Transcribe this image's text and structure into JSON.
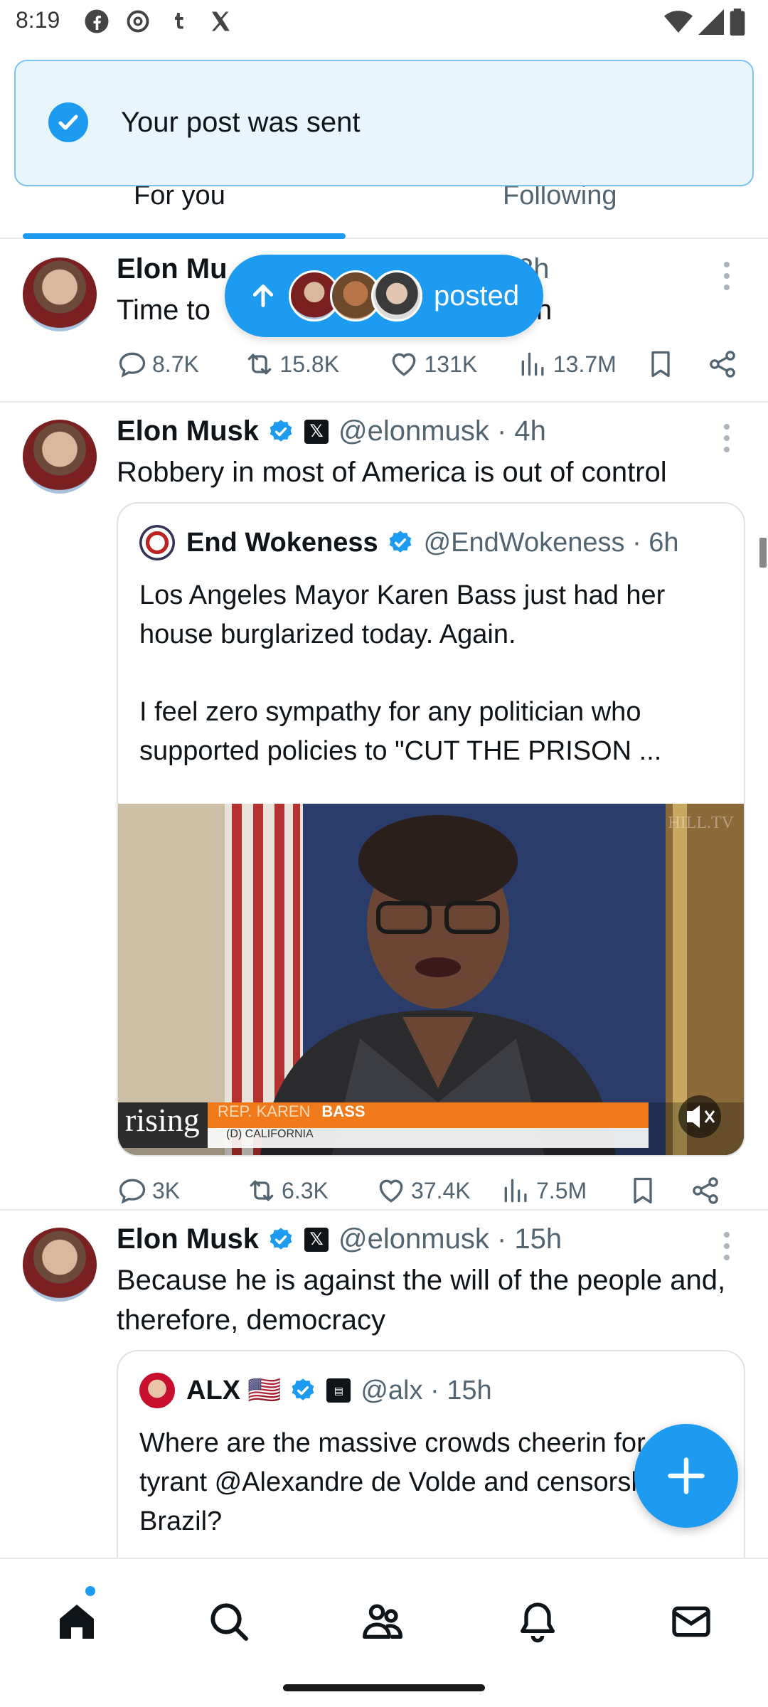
{
  "status_bar": {
    "time": "8:19"
  },
  "toast": {
    "message": "Your post was sent"
  },
  "tabs": [
    {
      "label": "For you",
      "active": true
    },
    {
      "label": "Following",
      "active": false
    }
  ],
  "new_posts_pill": {
    "label": "posted"
  },
  "posts": [
    {
      "author": "Elon Mu",
      "text": "Time to",
      "text_tail": "h",
      "time_fragment": "2h",
      "stats": {
        "replies": "8.7K",
        "reposts": "15.8K",
        "likes": "131K",
        "views": "13.7M"
      }
    },
    {
      "author": "Elon Musk",
      "handle": "@elonmusk · 4h",
      "text": "Robbery in most of America is out of control",
      "quote": {
        "author": "End Wokeness",
        "handle": "@EndWokeness · 6h",
        "text_p1": "Los Angeles Mayor Karen Bass just had her house burglarized today. Again.",
        "text_p2": "I feel zero sympathy for any politician who supported policies to \"CUT THE PRISON ...",
        "media": {
          "watermark": "HILL.TV",
          "show_logo": "rising",
          "lower_third_name": "REP. KAREN",
          "lower_third_name2": "BASS",
          "lower_third_sub": "(D) CALIFORNIA"
        }
      },
      "stats": {
        "replies": "3K",
        "reposts": "6.3K",
        "likes": "37.4K",
        "views": "7.5M"
      }
    },
    {
      "author": "Elon Musk",
      "handle": "@elonmusk · 15h",
      "text": "Because he is against the will of the people and, therefore, democracy",
      "quote": {
        "author": "ALX",
        "flag": "🇺🇸",
        "handle": "@alx · 15h",
        "text": "Where are the massive crowds cheerin for petty tyrant @Alexandre de Volde and censorship in Brazil?"
      }
    }
  ],
  "colors": {
    "accent": "#1d9bf0",
    "text": "#0f1419",
    "muted": "#536471"
  }
}
